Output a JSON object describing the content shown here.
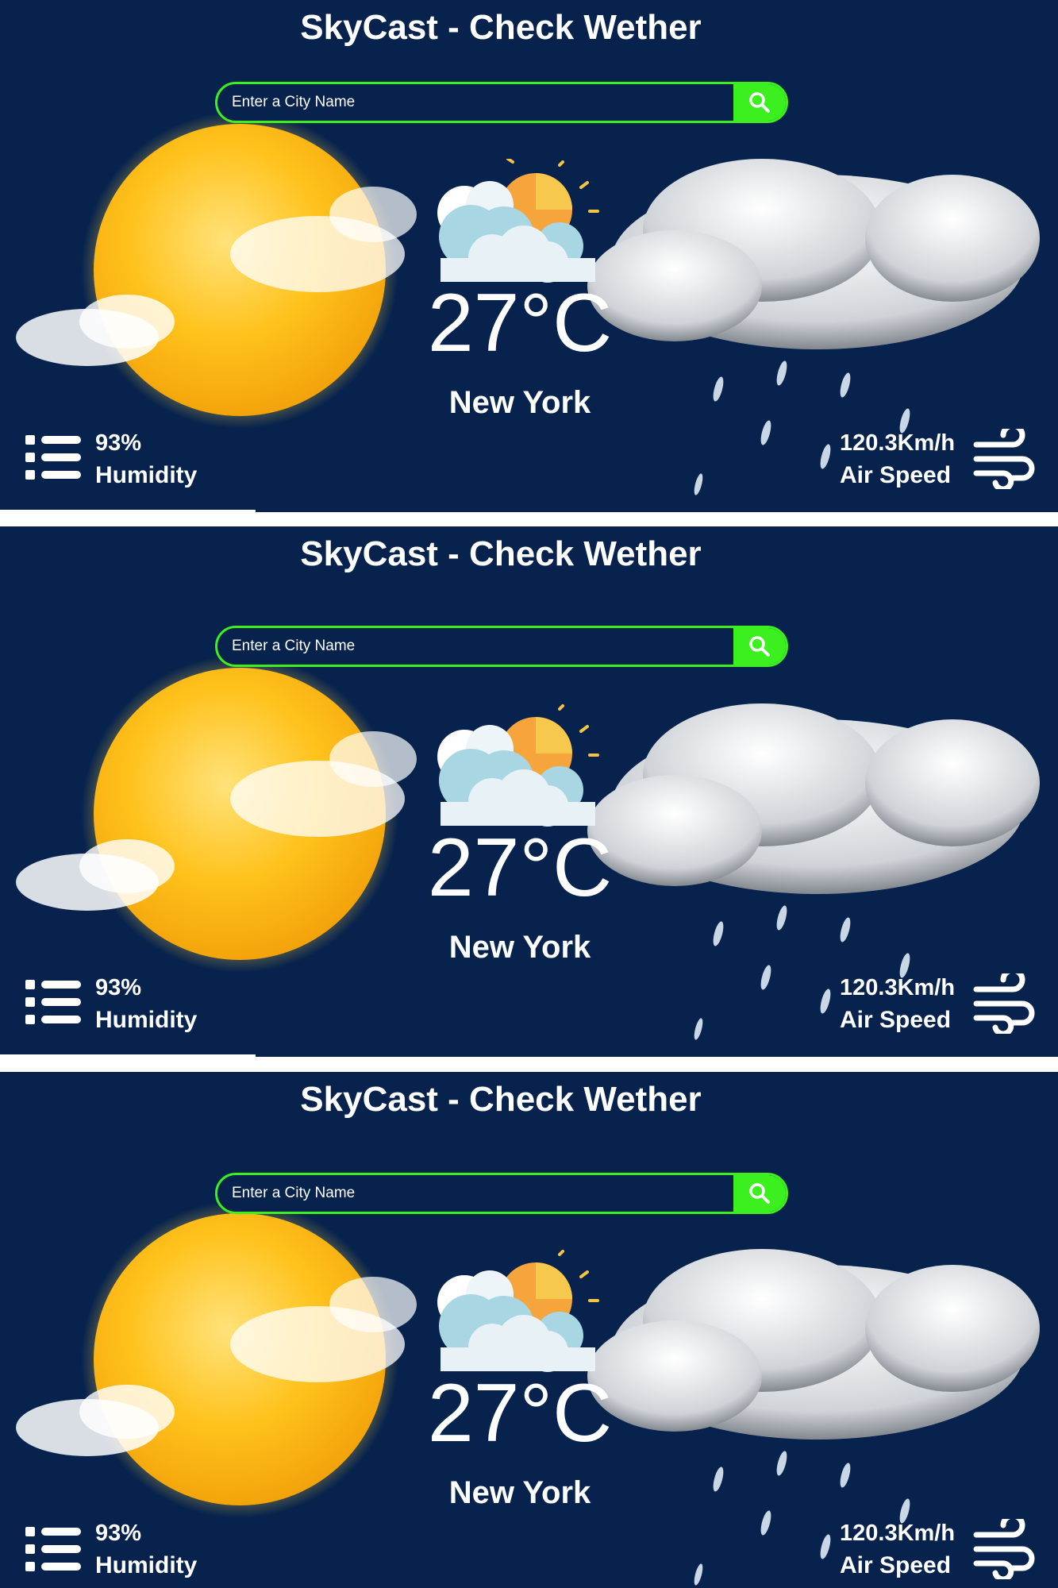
{
  "app": {
    "title": "SkyCast - Check Wether",
    "search_placeholder": "Enter a City Name"
  },
  "weather": {
    "temperature": "27°C",
    "city": "New York",
    "humidity_value": "93%",
    "humidity_label": "Humidity",
    "wind_value": "120.3Km/h",
    "wind_label": "Air Speed"
  },
  "icons": {
    "search": "search-icon",
    "weather": "partly-cloudy-icon",
    "humidity": "list-icon",
    "wind": "wind-icon"
  },
  "colors": {
    "background": "#06224d",
    "accent": "#3cf01f",
    "text": "#ffffff"
  }
}
